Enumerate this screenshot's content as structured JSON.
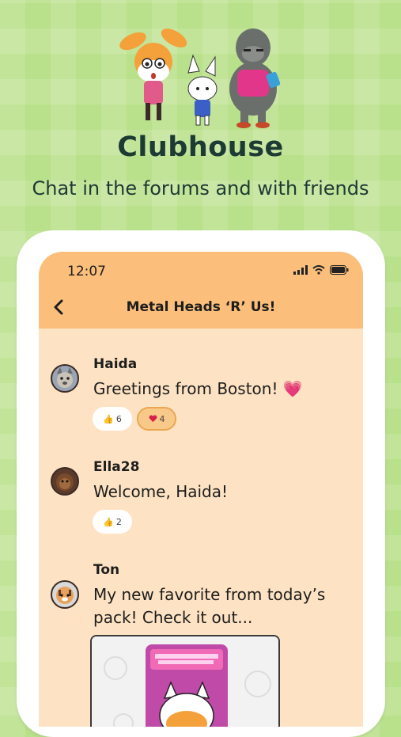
{
  "headline": "Clubhouse",
  "subheadline": "Chat in the forums and with friends",
  "phone": {
    "time": "12:07",
    "room_title": "Metal Heads ‘R’ Us!"
  },
  "messages": [
    {
      "author": "Haida",
      "text": "Greetings from Boston! 💗",
      "reactions": [
        {
          "icon": "thumbs-up-icon",
          "count": "6"
        },
        {
          "icon": "heart-icon",
          "count": "4"
        }
      ]
    },
    {
      "author": "Ella28",
      "text": "Welcome, Haida!",
      "reactions": [
        {
          "icon": "thumbs-up-icon",
          "count": "2"
        }
      ]
    },
    {
      "author": "Ton",
      "text": "My new favorite from today’s pack! Check it out...",
      "reactions": []
    }
  ],
  "colors": {
    "background": "#b9e08a",
    "header_bar": "#fbbf7b",
    "chat_background": "#fde3c3",
    "heading_text": "#1d3a33",
    "active_reaction": "#f9c98a"
  }
}
